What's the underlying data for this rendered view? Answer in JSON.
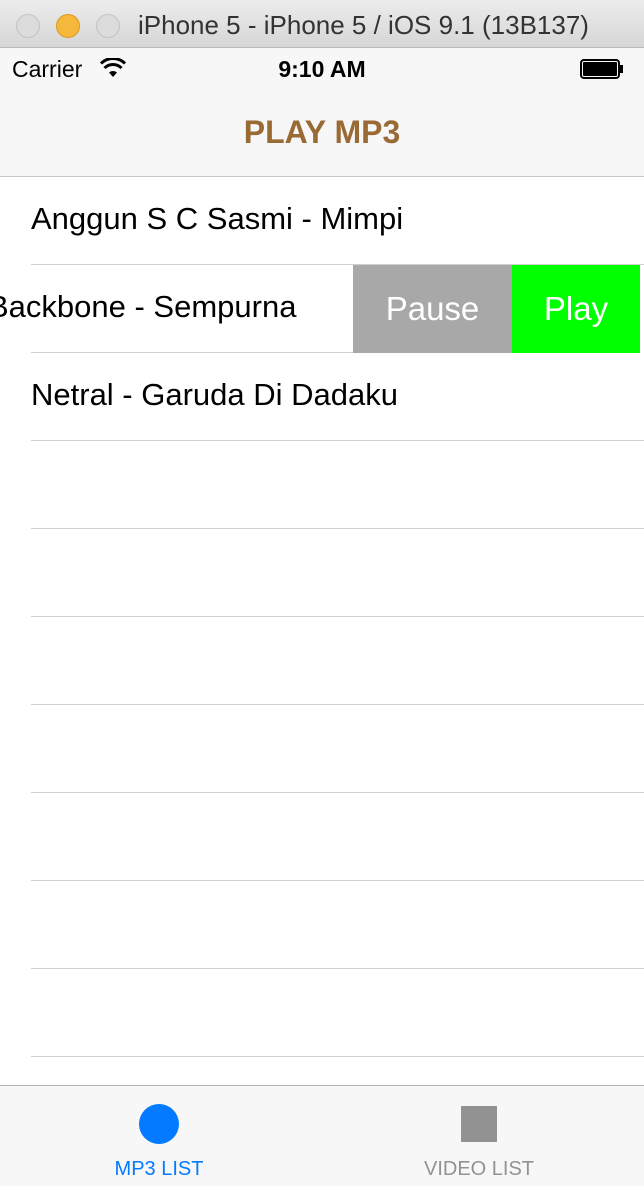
{
  "window": {
    "title": "iPhone 5 - iPhone 5 / iOS 9.1 (13B137)"
  },
  "status_bar": {
    "carrier": "Carrier",
    "time": "9:10 AM",
    "icons": [
      "wifi-icon",
      "battery-icon"
    ]
  },
  "nav": {
    "title": "PLAY MP3",
    "title_color": "#9a6a35"
  },
  "songs": [
    {
      "title": "Anggun S C Sasmi - Mimpi"
    },
    {
      "title": "Backbone - Sempurna"
    },
    {
      "title": "Netral - Garuda Di Dadaku"
    }
  ],
  "swipe_actions": {
    "pause_label": "Pause",
    "play_label": "Play",
    "pause_color": "#a8a8a8",
    "play_color": "#00ff00"
  },
  "tabs": [
    {
      "label": "MP3 LIST",
      "icon": "circle-icon",
      "selected": true,
      "color": "#037aff"
    },
    {
      "label": "VIDEO LIST",
      "icon": "square-icon",
      "selected": false,
      "color": "#929292"
    }
  ]
}
